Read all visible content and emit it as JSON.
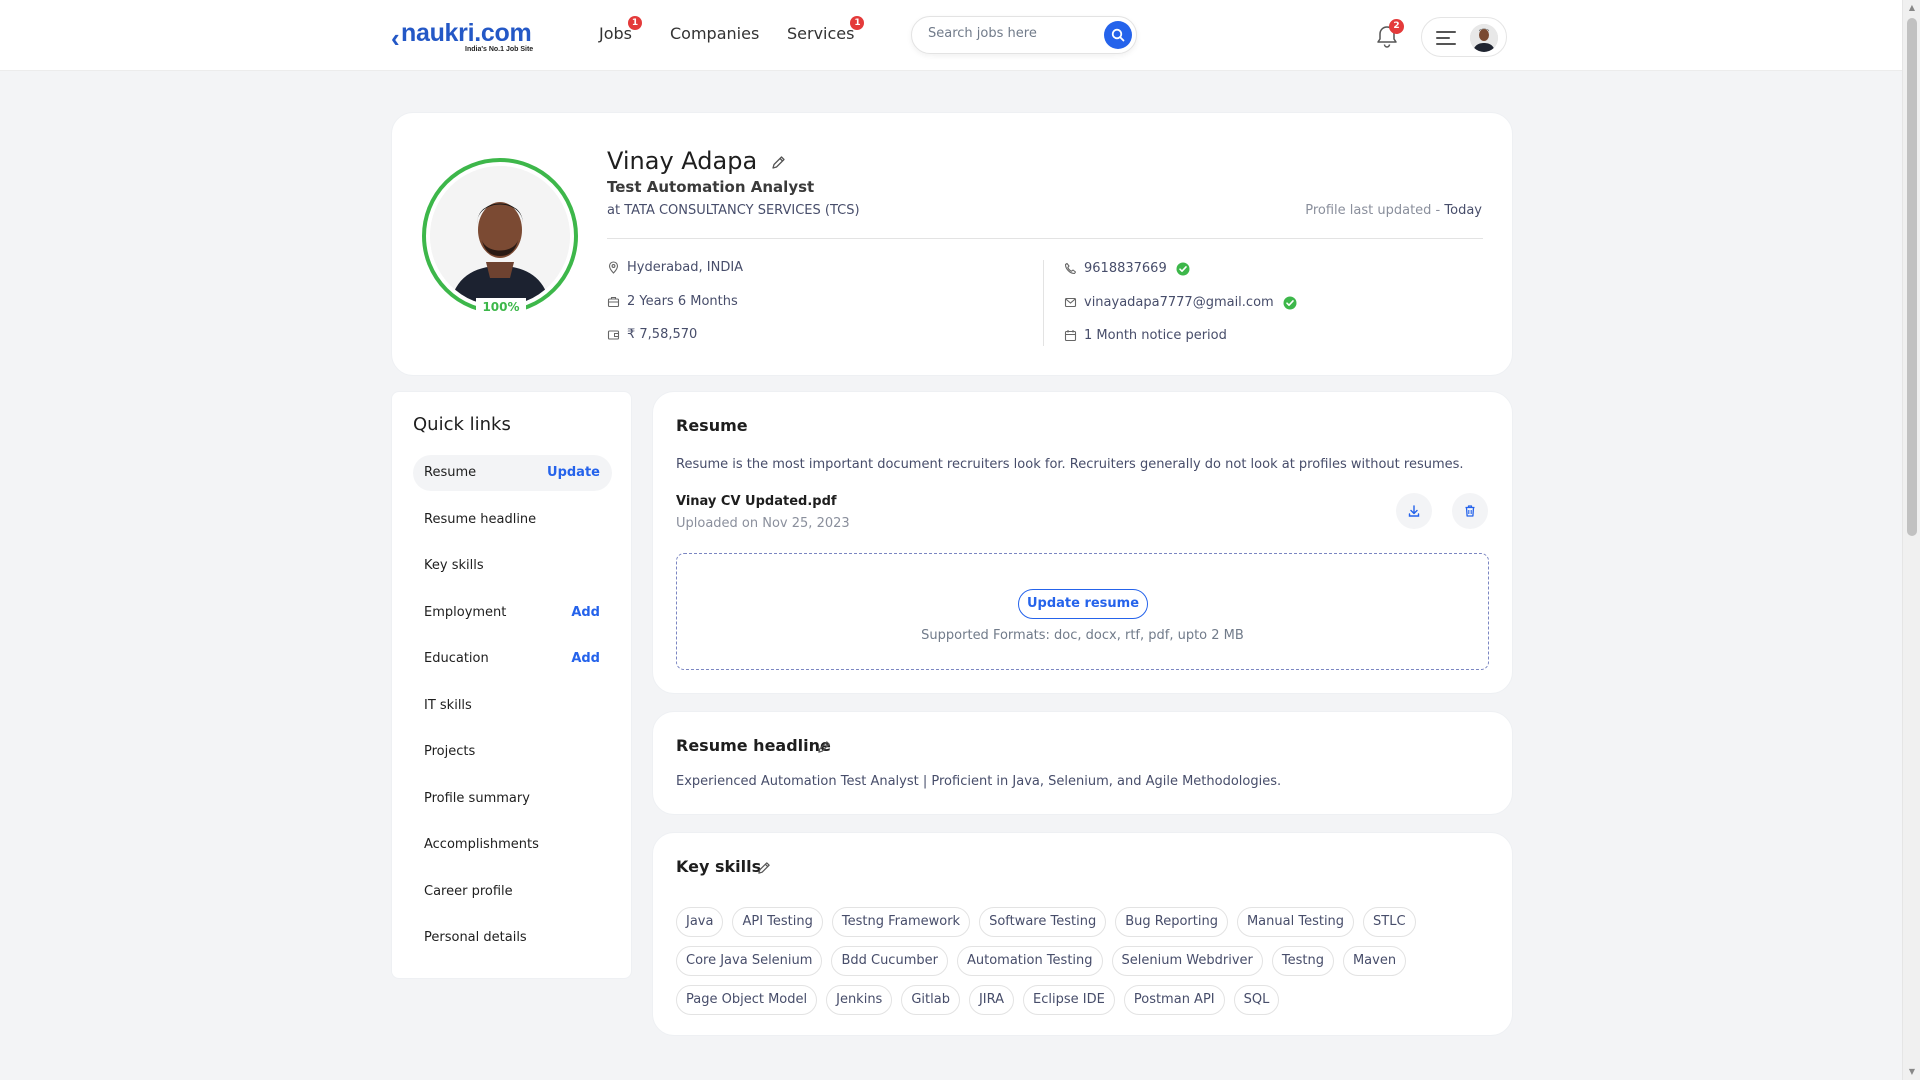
{
  "nav": {
    "logo_text": "naukri.com",
    "logo_tagline": "India's No.1 Job Site",
    "items": [
      {
        "label": "Jobs",
        "badge": "1"
      },
      {
        "label": "Companies",
        "badge": ""
      },
      {
        "label": "Services",
        "badge": "1"
      }
    ],
    "search_placeholder": "Search jobs here",
    "notification_count": "2"
  },
  "profile": {
    "name": "Vinay Adapa",
    "title": "Test Automation Analyst",
    "company": "at TATA CONSULTANCY SERVICES (TCS)",
    "updated_label": "Profile last updated - ",
    "updated_value": "Today",
    "completion": "100%",
    "location": "Hyderabad, INDIA",
    "experience": "2 Years 6 Months",
    "salary": "₹ 7,58,570",
    "phone": "9618837669",
    "email": "vinayadapa7777@gmail.com",
    "notice": "1 Month notice period",
    "accent_color": "#3db74a"
  },
  "quick_links": {
    "title": "Quick links",
    "items": [
      {
        "label": "Resume",
        "action": "Update"
      },
      {
        "label": "Resume headline",
        "action": ""
      },
      {
        "label": "Key skills",
        "action": ""
      },
      {
        "label": "Employment",
        "action": "Add"
      },
      {
        "label": "Education",
        "action": "Add"
      },
      {
        "label": "IT skills",
        "action": ""
      },
      {
        "label": "Projects",
        "action": ""
      },
      {
        "label": "Profile summary",
        "action": ""
      },
      {
        "label": "Accomplishments",
        "action": ""
      },
      {
        "label": "Career profile",
        "action": ""
      },
      {
        "label": "Personal details",
        "action": ""
      }
    ]
  },
  "resume": {
    "title": "Resume",
    "description": "Resume is the most important document recruiters look for. Recruiters generally do not look at profiles without resumes.",
    "file_name": "Vinay CV Updated.pdf",
    "uploaded": "Uploaded on Nov 25, 2023",
    "update_button": "Update resume",
    "formats": "Supported Formats: doc, docx, rtf, pdf, upto 2 MB"
  },
  "headline": {
    "title": "Resume headline",
    "text": "Experienced Automation Test Analyst | Proficient in Java, Selenium, and Agile Methodologies."
  },
  "skills": {
    "title": "Key skills",
    "rows": [
      [
        "Java",
        "API Testing",
        "Testng Framework",
        "Software Testing",
        "Bug Reporting",
        "Manual Testing",
        "STLC"
      ],
      [
        "Core Java Selenium",
        "Bdd Cucumber",
        "Automation Testing",
        "Selenium Webdriver",
        "Testng",
        "Maven"
      ],
      [
        "Page Object Model",
        "Jenkins",
        "Gitlab",
        "JIRA",
        "Eclipse IDE",
        "Postman API",
        "SQL"
      ]
    ]
  },
  "colors": {
    "brand": "#2458c6",
    "link": "#2563eb",
    "badge": "#e43a3a",
    "verified": "#3db74a"
  }
}
